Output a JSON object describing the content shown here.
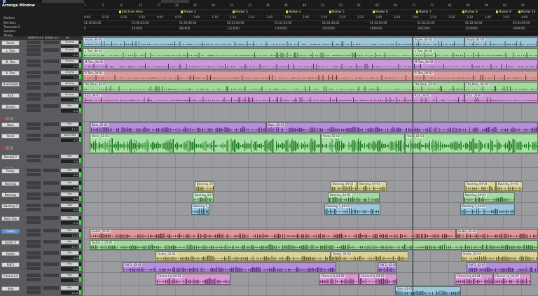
{
  "window": {
    "title": "Arrange Window",
    "accent": "#6aa3ff"
  },
  "rulers": {
    "labels": [
      "Markers",
      "Min:Secs",
      "Timecode 2",
      "Samples",
      "Tempo"
    ],
    "bars": [
      "1",
      "5",
      "9",
      "13",
      "17",
      "21",
      "25",
      "29",
      "33",
      "37",
      "41",
      "45",
      "49",
      "53",
      "57",
      "61",
      "65",
      "69",
      "73",
      "77",
      "81",
      "85",
      "89",
      "93",
      "97"
    ],
    "minsecs": [
      "0:00",
      "0:10",
      "0:20",
      "0:30",
      "0:40",
      "0:50",
      "1:00",
      "1:10",
      "1:20",
      "1:30",
      "1:40",
      "1:50",
      "2:00",
      "2:10",
      "2:20",
      "2:30",
      "2:40",
      "2:50",
      "3:00",
      "3:10",
      "3:20",
      "3:30",
      "3:40",
      "3:50",
      "4:00"
    ],
    "timecode": [
      "01:00:00:00",
      "01:00:20:00",
      "01:00:40:00",
      "01:01:00:00",
      "01:01:20:00",
      "01:01:40:00",
      "01:02:00:00",
      "01:02:20:00",
      "01:02:40:00",
      "01:03:00:00"
    ],
    "samples": [
      "0",
      "441000",
      "882000",
      "1323000",
      "1764000",
      "2205000",
      "2646000",
      "3087000",
      "3528000",
      "3969000"
    ],
    "markers": [
      "Edit From Here",
      "Marker 2",
      "Marker 3",
      "Marker 4",
      "Marker 5",
      "Marker 6",
      "Marker 7",
      "Marker 8",
      "Marker 9",
      "Marker 10"
    ]
  },
  "header_cols": {
    "inserts": "INSERTS A-E",
    "sends": "SENDS A-E",
    "io": "I/O"
  },
  "tracks": [
    {
      "name": "Snare",
      "output": "Drums",
      "vol": "0.0",
      "color": "#9fc6d8",
      "wave": "#2a5a70"
    },
    {
      "name": "L. Tom",
      "output": "Drums",
      "vol": "-2.4",
      "color": "#a6d7a0",
      "wave": "#2b6a2a"
    },
    {
      "name": "M. Tom",
      "output": "Drums",
      "vol": "-2.4",
      "color": "#c79ad8",
      "wave": "#5a2a78"
    },
    {
      "name": "R. Tom",
      "output": "Drums",
      "vol": "-3.1",
      "color": "#d99b9b",
      "wave": "#742a2a"
    },
    {
      "name": "Overheads",
      "output": "Drums",
      "vol": "-4.2",
      "color": "#a6d7a0",
      "wave": "#2b6a2a"
    },
    {
      "name": "Kick",
      "output": "Drums",
      "vol": "-1.8",
      "color": "#d19ad6",
      "wave": "#6e2f7a"
    },
    {
      "name": "Drums",
      "output": "Mix",
      "vol": "-4.6",
      "color": "#8d8f92",
      "wave": "#444"
    },
    {
      "name": "Bass",
      "output": "Mix",
      "vol": "-17.1",
      "color": "#b58fd9",
      "wave": "#5a2a8a"
    },
    {
      "name": "Vocal",
      "output": "Vocal Bus",
      "vol": "-4.2",
      "color": "#a6e0a6",
      "wave": "#1d7a1d"
    },
    {
      "name": "Reverb 2",
      "output": "Mix",
      "vol": "-5.6",
      "color": "#8d8f92",
      "wave": "#444"
    },
    {
      "name": "Delay",
      "output": "Mix",
      "vol": "-8.6",
      "color": "#8d8f92",
      "wave": "#444"
    },
    {
      "name": "Backing",
      "output": "Vox",
      "vol": "-8.6",
      "color": "#d9d39a",
      "wave": "#6a6120"
    },
    {
      "name": "Backing",
      "output": "Vox",
      "vol": "-8.6",
      "color": "#a6d7a0",
      "wave": "#2b6a2a"
    },
    {
      "name": "Backing 3",
      "output": "Vox",
      "vol": "-8.6",
      "color": "#9fc6d8",
      "wave": "#2a5a70"
    },
    {
      "name": "Back Vox",
      "output": "Mix",
      "vol": "-5.0",
      "color": "#8d8f92",
      "wave": "#444"
    },
    {
      "name": "Guitar",
      "output": "Mix",
      "vol": "-11.0",
      "color": "#d99b9b",
      "wave": "#742a2a"
    },
    {
      "name": "Guitar 2",
      "output": "Mix",
      "vol": "-10.3",
      "color": "#a6d7a0",
      "wave": "#2b6a2a"
    },
    {
      "name": "Guitar",
      "output": "Mix",
      "vol": "-9.6",
      "color": "#d9d39a",
      "wave": "#6a6120"
    },
    {
      "name": "Riff 2",
      "output": "Mix",
      "vol": "-9.8",
      "color": "#b58fd9",
      "wave": "#5a2a8a"
    },
    {
      "name": "Chorus Ld",
      "output": "Vox",
      "vol": "-7.8",
      "color": "#d69ad0",
      "wave": "#6e2f6a"
    },
    {
      "name": "Solo",
      "output": "Mix",
      "vol": "-10.6",
      "color": "#9fc6d8",
      "wave": "#2a5a70"
    }
  ],
  "clips": [
    {
      "lane": 0,
      "name": "Snare_04-01",
      "start": 0,
      "end": 471
    },
    {
      "lane": 0,
      "name": "Snare_04-02",
      "start": 471,
      "end": 545
    },
    {
      "lane": 0,
      "name": "Snare_04-03",
      "start": 545,
      "end": 650
    },
    {
      "lane": 1,
      "name": "L Tom_04-01",
      "start": 0,
      "end": 471
    },
    {
      "lane": 1,
      "name": "L Tom_04-02",
      "start": 471,
      "end": 650
    },
    {
      "lane": 2,
      "name": "M Tom_04-01",
      "start": 0,
      "end": 471
    },
    {
      "lane": 2,
      "name": "M Tom_04-02",
      "start": 471,
      "end": 650
    },
    {
      "lane": 3,
      "name": "R Tom_04-01",
      "start": 0,
      "end": 471
    },
    {
      "lane": 3,
      "name": "R Tom_04-02",
      "start": 471,
      "end": 650
    },
    {
      "lane": 4,
      "name": "OH_Near_04-01",
      "start": 0,
      "end": 471
    },
    {
      "lane": 4,
      "name": "OH_Near_04-02",
      "start": 471,
      "end": 545
    },
    {
      "lane": 4,
      "name": "OH_Near_04-03",
      "start": 545,
      "end": 650
    },
    {
      "lane": 5,
      "name": "Kick_04-01",
      "start": 0,
      "end": 471
    },
    {
      "lane": 5,
      "name": "Kick_04-02",
      "start": 471,
      "end": 545
    },
    {
      "lane": 5,
      "name": "Kick_04-03",
      "start": 545,
      "end": 650
    },
    {
      "lane": 7,
      "name": "Bass_02-01",
      "start": 10,
      "end": 262
    },
    {
      "lane": 7,
      "name": "Bass_02-02",
      "start": 262,
      "end": 650
    },
    {
      "lane": 8,
      "name": "Vocal_02-01",
      "start": 10,
      "end": 340
    },
    {
      "lane": 8,
      "name": "Vocal_02-02",
      "start": 340,
      "end": 460
    },
    {
      "lane": 8,
      "name": "Vocal_02-03",
      "start": 460,
      "end": 650
    },
    {
      "lane": 11,
      "name": "Backing_04-01",
      "start": 160,
      "end": 188
    },
    {
      "lane": 11,
      "name": "Backing_04-02",
      "start": 354,
      "end": 392
    },
    {
      "lane": 11,
      "name": "Backing_04-03",
      "start": 392,
      "end": 434
    },
    {
      "lane": 11,
      "name": "Backing_04-04",
      "start": 545,
      "end": 590
    },
    {
      "lane": 11,
      "name": "Backing_04-05",
      "start": 590,
      "end": 628
    },
    {
      "lane": 12,
      "name": "Backing_04-01",
      "start": 157,
      "end": 187
    },
    {
      "lane": 12,
      "name": "Backing_04-02",
      "start": 350,
      "end": 424
    },
    {
      "lane": 12,
      "name": "Backing_04-03",
      "start": 543,
      "end": 617
    },
    {
      "lane": 13,
      "name": "Backing 3_04-01",
      "start": 155,
      "end": 181
    },
    {
      "lane": 13,
      "name": "Backing 3_04-02",
      "start": 345,
      "end": 425
    },
    {
      "lane": 13,
      "name": "Backing 3_04-03",
      "start": 539,
      "end": 617
    },
    {
      "lane": 15,
      "name": "Guitar_02-01",
      "start": 10,
      "end": 533
    },
    {
      "lane": 15,
      "name": "Guitar_02-02",
      "start": 533,
      "end": 650
    },
    {
      "lane": 16,
      "name": "Guitar 2_02-01",
      "start": 10,
      "end": 650
    },
    {
      "lane": 17,
      "name": "Guitar_02-01",
      "start": 104,
      "end": 354
    },
    {
      "lane": 17,
      "name": "Guitar_02-02",
      "start": 354,
      "end": 465
    },
    {
      "lane": 17,
      "name": "Guitar_02-03",
      "start": 540,
      "end": 650
    },
    {
      "lane": 18,
      "name": "Riff 2_02-01",
      "start": 57,
      "end": 362
    },
    {
      "lane": 18,
      "name": "Riff 2_02-02",
      "start": 421,
      "end": 448
    },
    {
      "lane": 18,
      "name": "Riff 2_02-03",
      "start": 548,
      "end": 650
    },
    {
      "lane": 19,
      "name": "Chorus Ld_04-01",
      "start": 104,
      "end": 211
    },
    {
      "lane": 19,
      "name": "Chorus Ld_04-02",
      "start": 337,
      "end": 394
    },
    {
      "lane": 19,
      "name": "Chorus Ld_04-03",
      "start": 394,
      "end": 449
    },
    {
      "lane": 19,
      "name": "Chorus Ld_04-04",
      "start": 531,
      "end": 586
    },
    {
      "lane": 19,
      "name": "Chorus Ld_04-05",
      "start": 586,
      "end": 640
    },
    {
      "lane": 20,
      "name": "Solo_02-01",
      "start": 446,
      "end": 540
    }
  ]
}
